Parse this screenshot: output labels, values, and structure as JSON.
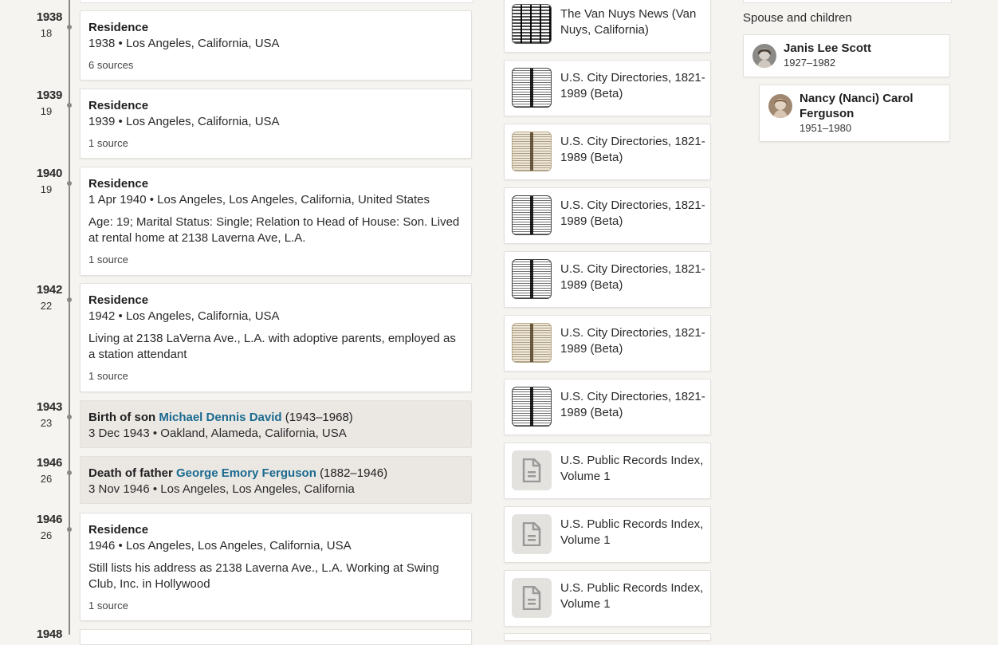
{
  "timeline": {
    "years": [
      {
        "year": "1938",
        "age": "18"
      },
      {
        "year": "1939",
        "age": "19"
      },
      {
        "year": "1940",
        "age": "19"
      },
      {
        "year": "1942",
        "age": "22"
      },
      {
        "year": "1943",
        "age": "23"
      },
      {
        "year": "1946",
        "age": "26"
      },
      {
        "year": "1946",
        "age": "26"
      },
      {
        "year": "1948",
        "age": ""
      }
    ],
    "events": [
      {
        "title": "Residence",
        "sub": "1938 • Los Angeles, California, USA",
        "sources": "6 sources"
      },
      {
        "title": "Residence",
        "sub": "1939 • Los Angeles, California, USA",
        "sources": "1 source"
      },
      {
        "title": "Residence",
        "sub": "1 Apr 1940 • Los Angeles, Los Angeles, California, United States",
        "desc": "Age: 19; Marital Status: Single; Relation to Head of House: Son. Lived at rental home at 2138 Laverna Ave, L.A.",
        "sources": "1 source"
      },
      {
        "title": "Residence",
        "sub": "1942 • Los Angeles, California, USA",
        "desc": "Living at 2138 LaVerna Ave., L.A. with adoptive parents, employed as a station attendant",
        "sources": "1 source"
      },
      {
        "relation": "Birth of son",
        "person": "Michael Dennis David",
        "lifespan": "(1943–1968)",
        "sub": "3 Dec 1943 • Oakland, Alameda, California, USA"
      },
      {
        "relation": "Death of father",
        "person": "George Emory Ferguson",
        "lifespan": "(1882–1946)",
        "sub": "3 Nov 1946 • Los Angeles, Los Angeles, California"
      },
      {
        "title": "Residence",
        "sub": "1946 • Los Angeles, Los Angeles, California, USA",
        "desc": "Still lists his address as 2138 Laverna Ave., L.A. Working at Swing Club, Inc. in Hollywood",
        "sources": "1 source"
      }
    ]
  },
  "records": [
    {
      "title": "The Van Nuys News (Van Nuys, California)",
      "thumb": "newspaper"
    },
    {
      "title": "U.S. City Directories, 1821-1989 (Beta)",
      "thumb": "directory"
    },
    {
      "title": "U.S. City Directories, 1821-1989 (Beta)",
      "thumb": "directory-sepia"
    },
    {
      "title": "U.S. City Directories, 1821-1989 (Beta)",
      "thumb": "directory"
    },
    {
      "title": "U.S. City Directories, 1821-1989 (Beta)",
      "thumb": "directory"
    },
    {
      "title": "U.S. City Directories, 1821-1989 (Beta)",
      "thumb": "directory-sepia"
    },
    {
      "title": "U.S. City Directories, 1821-1989 (Beta)",
      "thumb": "directory"
    },
    {
      "title": "U.S. Public Records Index, Volume 1",
      "thumb": "document-icon"
    },
    {
      "title": "U.S. Public Records Index, Volume 1",
      "thumb": "document-icon"
    },
    {
      "title": "U.S. Public Records Index, Volume 1",
      "thumb": "document-icon"
    }
  ],
  "family": {
    "heading": "Spouse and children",
    "spouse": {
      "name": "Janis Lee Scott",
      "dates": "1927–1982"
    },
    "children": [
      {
        "name_line1": "Nancy (Nanci) Carol",
        "name_line2": "Ferguson",
        "dates": "1951–1980"
      }
    ]
  },
  "colors": {
    "link": "#1a6a8f",
    "background": "#f6f4f1",
    "family_event_bg": "#ebe8e4"
  }
}
